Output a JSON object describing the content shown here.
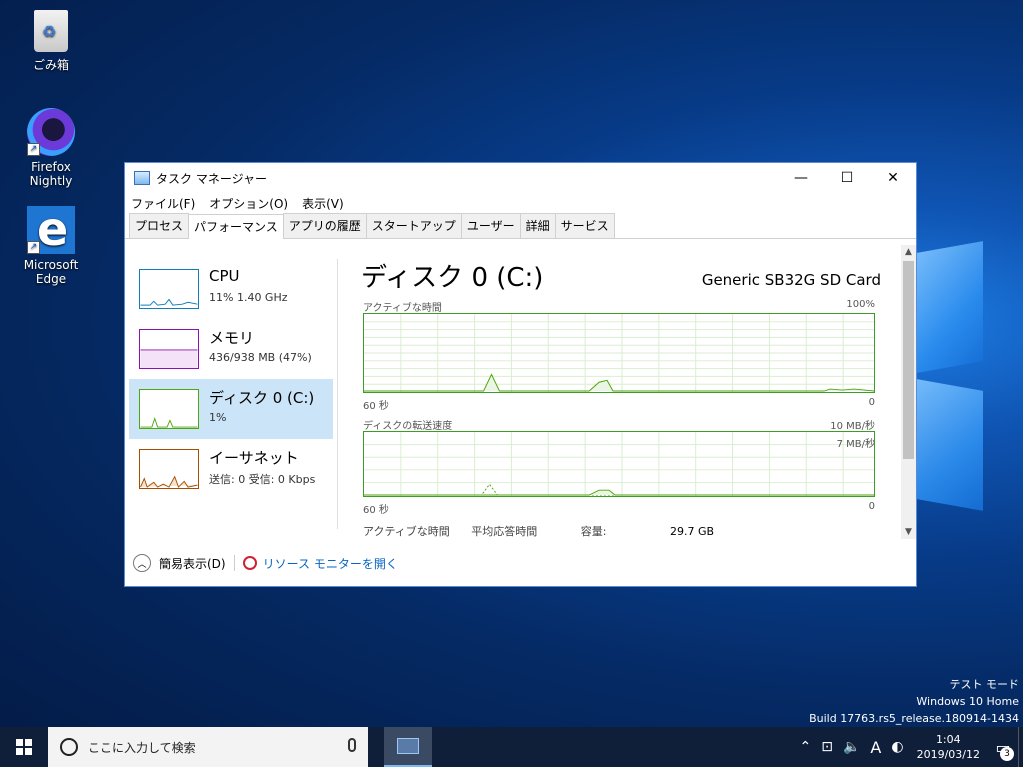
{
  "desktop": {
    "icons": [
      {
        "label": "ごみ箱"
      },
      {
        "label": "Firefox Nightly"
      },
      {
        "label": "Microsoft Edge"
      }
    ],
    "watermark": {
      "line1": "テスト モード",
      "line2": "Windows 10 Home",
      "line3": "Build 17763.rs5_release.180914-1434"
    }
  },
  "window": {
    "title": "タスク マネージャー",
    "controls": {
      "minimize": "—",
      "maximize": "☐",
      "close": "✕"
    },
    "menu": [
      "ファイル(F)",
      "オプション(O)",
      "表示(V)"
    ],
    "tabs": [
      "プロセス",
      "パフォーマンス",
      "アプリの履歴",
      "スタートアップ",
      "ユーザー",
      "詳細",
      "サービス"
    ],
    "active_tab": "パフォーマンス",
    "sidebar": [
      {
        "name": "CPU",
        "sub": "11% 1.40 GHz",
        "color": "#117dbb"
      },
      {
        "name": "メモリ",
        "sub": "436/938 MB (47%)",
        "color": "#8b12ae"
      },
      {
        "name": "ディスク 0 (C:)",
        "sub": "1%",
        "color": "#4da60c"
      },
      {
        "name": "イーサネット",
        "sub": "送信: 0 受信: 0 Kbps",
        "color": "#a74f01"
      }
    ],
    "main": {
      "title": "ディスク 0 (C:)",
      "model": "Generic SB32G SD Card",
      "graph1": {
        "label": "アクティブな時間",
        "max": "100%",
        "time": "60 秒",
        "min": "0"
      },
      "graph2": {
        "label": "ディスクの転送速度",
        "max": "10 MB/秒",
        "inner_max": "7 MB/秒",
        "time": "60 秒",
        "min": "0"
      },
      "stats": {
        "active_label": "アクティブな時間",
        "avg_label": "平均応答時間",
        "capacity_label": "容量:",
        "capacity_value": "29.7 GB"
      }
    },
    "footer": {
      "fewer_details": "簡易表示(D)",
      "resource_monitor": "リソース モニターを開く"
    }
  },
  "taskbar": {
    "search_placeholder": "ここに入力して検索",
    "ime": "A",
    "time": "1:04",
    "date": "2019/03/12",
    "notification_count": "3"
  },
  "colors": {
    "disk_graph": "#4da60c",
    "selection": "#cce4f7",
    "taskbar": "#0f1f3a"
  }
}
